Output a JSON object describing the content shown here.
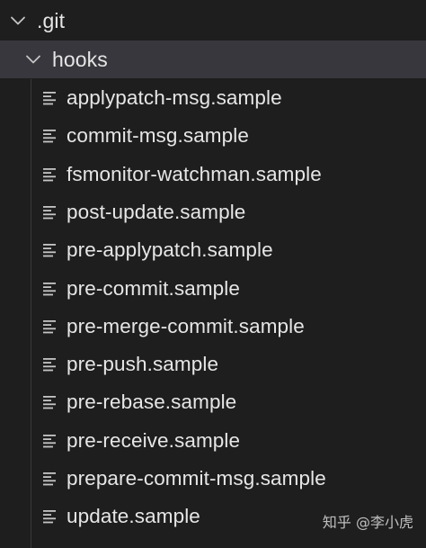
{
  "explorer": {
    "root_folder": {
      "label": ".git",
      "icon": "chevron-down-icon",
      "expanded": true
    },
    "subfolder": {
      "label": "hooks",
      "icon": "chevron-down-icon",
      "expanded": true,
      "selected": true
    },
    "files": [
      {
        "label": "applypatch-msg.sample",
        "icon": "file-lines-icon"
      },
      {
        "label": "commit-msg.sample",
        "icon": "file-lines-icon"
      },
      {
        "label": "fsmonitor-watchman.sample",
        "icon": "file-lines-icon"
      },
      {
        "label": "post-update.sample",
        "icon": "file-lines-icon"
      },
      {
        "label": "pre-applypatch.sample",
        "icon": "file-lines-icon"
      },
      {
        "label": "pre-commit.sample",
        "icon": "file-lines-icon"
      },
      {
        "label": "pre-merge-commit.sample",
        "icon": "file-lines-icon"
      },
      {
        "label": "pre-push.sample",
        "icon": "file-lines-icon"
      },
      {
        "label": "pre-rebase.sample",
        "icon": "file-lines-icon"
      },
      {
        "label": "pre-receive.sample",
        "icon": "file-lines-icon"
      },
      {
        "label": "prepare-commit-msg.sample",
        "icon": "file-lines-icon"
      },
      {
        "label": "update.sample",
        "icon": "file-lines-icon"
      }
    ]
  },
  "watermark": {
    "text": "知乎 @李小虎"
  },
  "colors": {
    "background": "#1e1e1e",
    "selected_row": "#37373d",
    "text": "#e6e6e6",
    "icon": "#c5c5c5"
  }
}
